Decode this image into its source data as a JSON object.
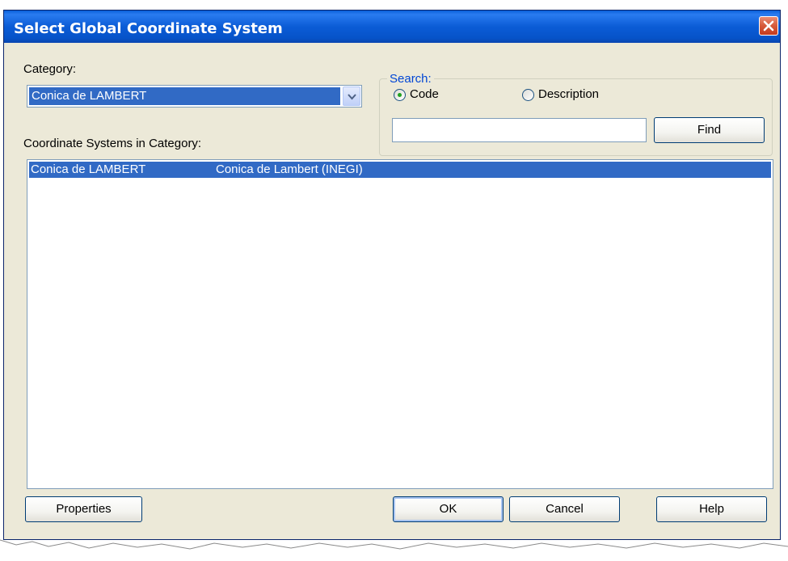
{
  "window": {
    "title": "Select Global Coordinate System"
  },
  "icons": {
    "close": "close-icon",
    "dropdown": "chevron-down-icon"
  },
  "category": {
    "label": "Category:",
    "selected": "Conica de LAMBERT"
  },
  "search": {
    "legend": "Search:",
    "options": [
      {
        "label": "Code",
        "checked": true
      },
      {
        "label": "Description",
        "checked": false
      }
    ],
    "input_value": "",
    "find_label": "Find"
  },
  "list": {
    "label": "Coordinate Systems in Category:",
    "rows": [
      {
        "code": "Conica de LAMBERT",
        "description": "Conica de Lambert (INEGI)",
        "selected": true
      }
    ]
  },
  "buttons": {
    "properties": "Properties",
    "ok": "OK",
    "cancel": "Cancel",
    "help": "Help"
  },
  "colors": {
    "titlebar": "#0a5fd8",
    "dialog_bg": "#ece9d8",
    "selection": "#316ac5",
    "group_legend": "#0046d5"
  }
}
